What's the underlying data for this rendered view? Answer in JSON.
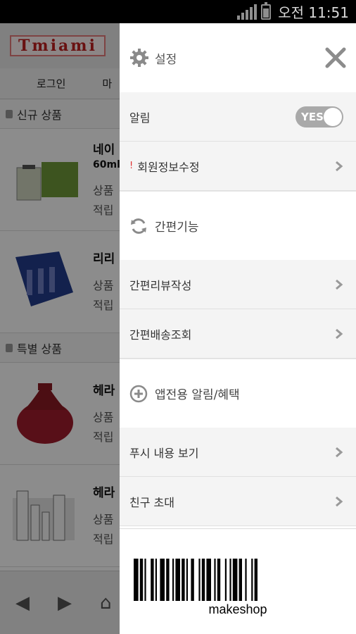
{
  "status_bar": {
    "time": "오전 11:51"
  },
  "background_app": {
    "logo": "Tmiami",
    "nav": [
      "로그인",
      "마"
    ],
    "sections": [
      {
        "title": "신규 상품",
        "products": [
          {
            "name": "네이",
            "sub": "60ml",
            "line1": "상품",
            "line2": "적립"
          },
          {
            "name": "리리",
            "line1": "상품",
            "line2": "적립"
          }
        ]
      },
      {
        "title": "특별 상품",
        "products": [
          {
            "name": "헤라",
            "line1": "상품",
            "line2": "적립"
          },
          {
            "name": "헤라",
            "line1": "상품",
            "line2": "적립"
          }
        ]
      }
    ]
  },
  "drawer": {
    "header": {
      "title": "설정",
      "icon": "gear-icon"
    },
    "notification": {
      "label": "알림",
      "toggle_text": "YES"
    },
    "member_edit": {
      "label": "회원정보수정",
      "warn": "!"
    },
    "quick": {
      "title": "간편기능",
      "icon": "refresh-icon",
      "items": [
        "간편리뷰작성",
        "간편배송조회"
      ]
    },
    "app_only": {
      "title": "앱전용 알림/혜택",
      "icon": "plus-circle-icon",
      "items": [
        "푸시 내용 보기",
        "친구 초대"
      ]
    },
    "barcode_text": "makeshop"
  },
  "colors": {
    "toggle_bg": "#a9a9a9",
    "warn": "#e03030",
    "row_bg": "#f4f4f4"
  }
}
